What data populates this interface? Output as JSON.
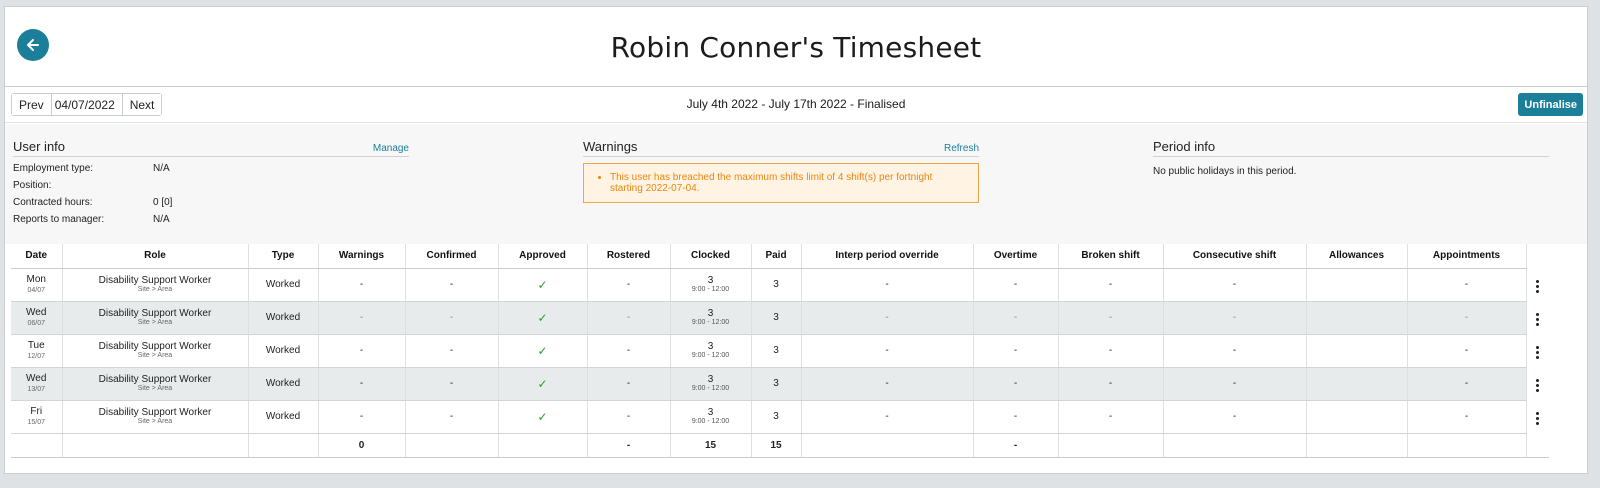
{
  "header": {
    "title": "Robin Conner's Timesheet",
    "back_icon": "arrow-left-icon"
  },
  "toolbar": {
    "prev_label": "Prev",
    "date_value": "04/07/2022",
    "next_label": "Next",
    "period": "July 4th 2022 - July 17th 2022 - Finalised",
    "unfinalise_label": "Unfinalise"
  },
  "user_info": {
    "title": "User info",
    "action": "Manage",
    "fields": [
      {
        "label": "Employment type:",
        "value": "N/A"
      },
      {
        "label": "Position:",
        "value": ""
      },
      {
        "label": "Contracted hours:",
        "value": "0 [0]"
      },
      {
        "label": "Reports to manager:",
        "value": "N/A"
      }
    ]
  },
  "warnings": {
    "title": "Warnings",
    "action": "Refresh",
    "items": [
      "This user has breached the maximum shifts limit of 4 shift(s) per fortnight starting 2022-07-04."
    ]
  },
  "period_info": {
    "title": "Period info",
    "text": "No public holidays in this period."
  },
  "table": {
    "columns": [
      "Date",
      "Role",
      "Type",
      "Warnings",
      "Confirmed",
      "Approved",
      "Rostered",
      "Clocked",
      "Paid",
      "Interp period override",
      "Overtime",
      "Broken shift",
      "Consecutive shift",
      "Allowances",
      "Appointments"
    ],
    "rows": [
      {
        "day": "Mon",
        "date": "04/07",
        "role": "Disability Support Worker",
        "location": "Site > Area",
        "type": "Worked",
        "warnings": "-",
        "confirmed": "-",
        "approved": "✓",
        "rostered": "-",
        "clocked": "3",
        "clocked_time": "9:00 - 12:00",
        "paid": "3",
        "interp": "-",
        "overtime": "-",
        "broken": "-",
        "consecutive": "-",
        "allowances": "",
        "appointments": "-"
      },
      {
        "day": "Wed",
        "date": "06/07",
        "role": "Disability Support Worker",
        "location": "Site > Area",
        "type": "Worked",
        "warnings": "-",
        "confirmed": "-",
        "approved": "✓",
        "rostered": "-",
        "clocked": "3",
        "clocked_time": "9:00 - 12:00",
        "paid": "3",
        "interp": "-",
        "overtime": "-",
        "broken": "-",
        "consecutive": "-",
        "allowances": "",
        "appointments": "-"
      },
      {
        "day": "Tue",
        "date": "12/07",
        "role": "Disability Support Worker",
        "location": "Site > Area",
        "type": "Worked",
        "warnings": "-",
        "confirmed": "-",
        "approved": "✓",
        "rostered": "-",
        "clocked": "3",
        "clocked_time": "9:00 - 12:00",
        "paid": "3",
        "interp": "-",
        "overtime": "-",
        "broken": "-",
        "consecutive": "-",
        "allowances": "",
        "appointments": "-"
      },
      {
        "day": "Wed",
        "date": "13/07",
        "role": "Disability Support Worker",
        "location": "Site > Area",
        "type": "Worked",
        "warnings": "-",
        "confirmed": "-",
        "approved": "✓",
        "rostered": "-",
        "clocked": "3",
        "clocked_time": "9:00 - 12:00",
        "paid": "3",
        "interp": "-",
        "overtime": "-",
        "broken": "-",
        "consecutive": "-",
        "allowances": "",
        "appointments": "-"
      },
      {
        "day": "Fri",
        "date": "15/07",
        "role": "Disability Support Worker",
        "location": "Site > Area",
        "type": "Worked",
        "warnings": "-",
        "confirmed": "-",
        "approved": "✓",
        "rostered": "-",
        "clocked": "3",
        "clocked_time": "9:00 - 12:00",
        "paid": "3",
        "interp": "-",
        "overtime": "-",
        "broken": "-",
        "consecutive": "-",
        "allowances": "",
        "appointments": "-"
      }
    ],
    "totals": {
      "warnings": "0",
      "rostered": "-",
      "clocked": "15",
      "paid": "15",
      "overtime": "-"
    }
  },
  "colors": {
    "accent": "#1c7f9a",
    "warning_text": "#e8870f",
    "approved_check": "#2a9d2a"
  }
}
